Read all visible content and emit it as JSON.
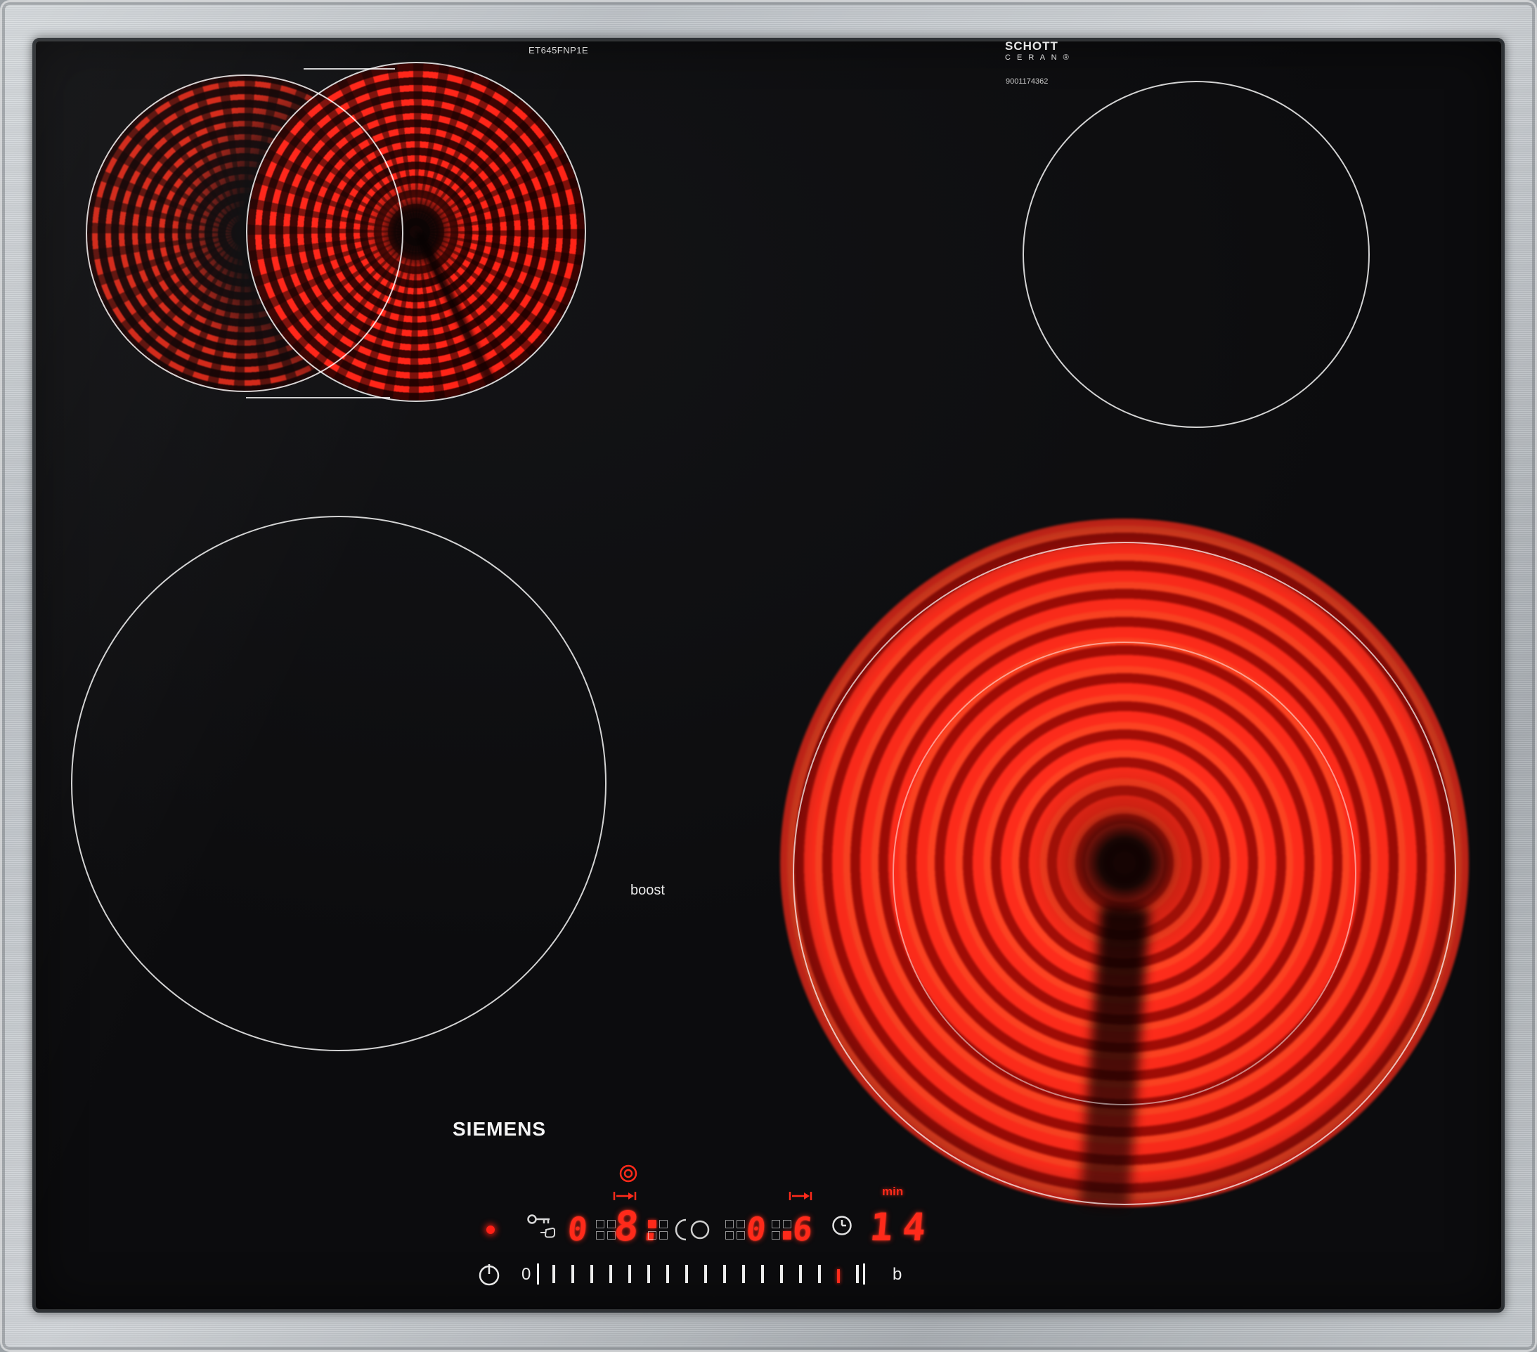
{
  "labels": {
    "model": "ET645FNP1E",
    "brand": "SIEMENS",
    "glass_logo_line1": "SCHOTT",
    "glass_logo_line2": "C E R A N ®",
    "serial": "9001174362",
    "boost": "boost"
  },
  "zones": {
    "rear_left": {
      "state": "on",
      "shape": "dual-oval"
    },
    "rear_right": {
      "state": "off"
    },
    "front_left": {
      "state": "off"
    },
    "front_right": {
      "state": "on",
      "shape": "dual-circle"
    }
  },
  "panel": {
    "led_on": true,
    "displays": [
      {
        "id": "display-1",
        "value": "0"
      },
      {
        "id": "display-2",
        "value": "8."
      },
      {
        "id": "display-3",
        "value": "0"
      },
      {
        "id": "display-4",
        "value": "6"
      }
    ],
    "timer": {
      "value": "14",
      "unit": "min"
    },
    "slider": {
      "start": "0",
      "end": "b",
      "ticks": 17,
      "red_tick_index": 15
    },
    "icons": [
      "childlock-key-hand-icon",
      "target-icon",
      "arrow-to-bar-icon",
      "dual-zone-icon",
      "clock-icon",
      "power-icon",
      "zone-select-grid"
    ],
    "colors": {
      "display_red": "#ff2a1a",
      "tick_white": "#ededed"
    }
  },
  "colors": {
    "glass_black": "#0c0c0e",
    "steel_light": "#d9dde0",
    "steel_dark": "#a9aeb3",
    "glow_red": "#ff2d1c",
    "outline_white": "#ffffff"
  }
}
